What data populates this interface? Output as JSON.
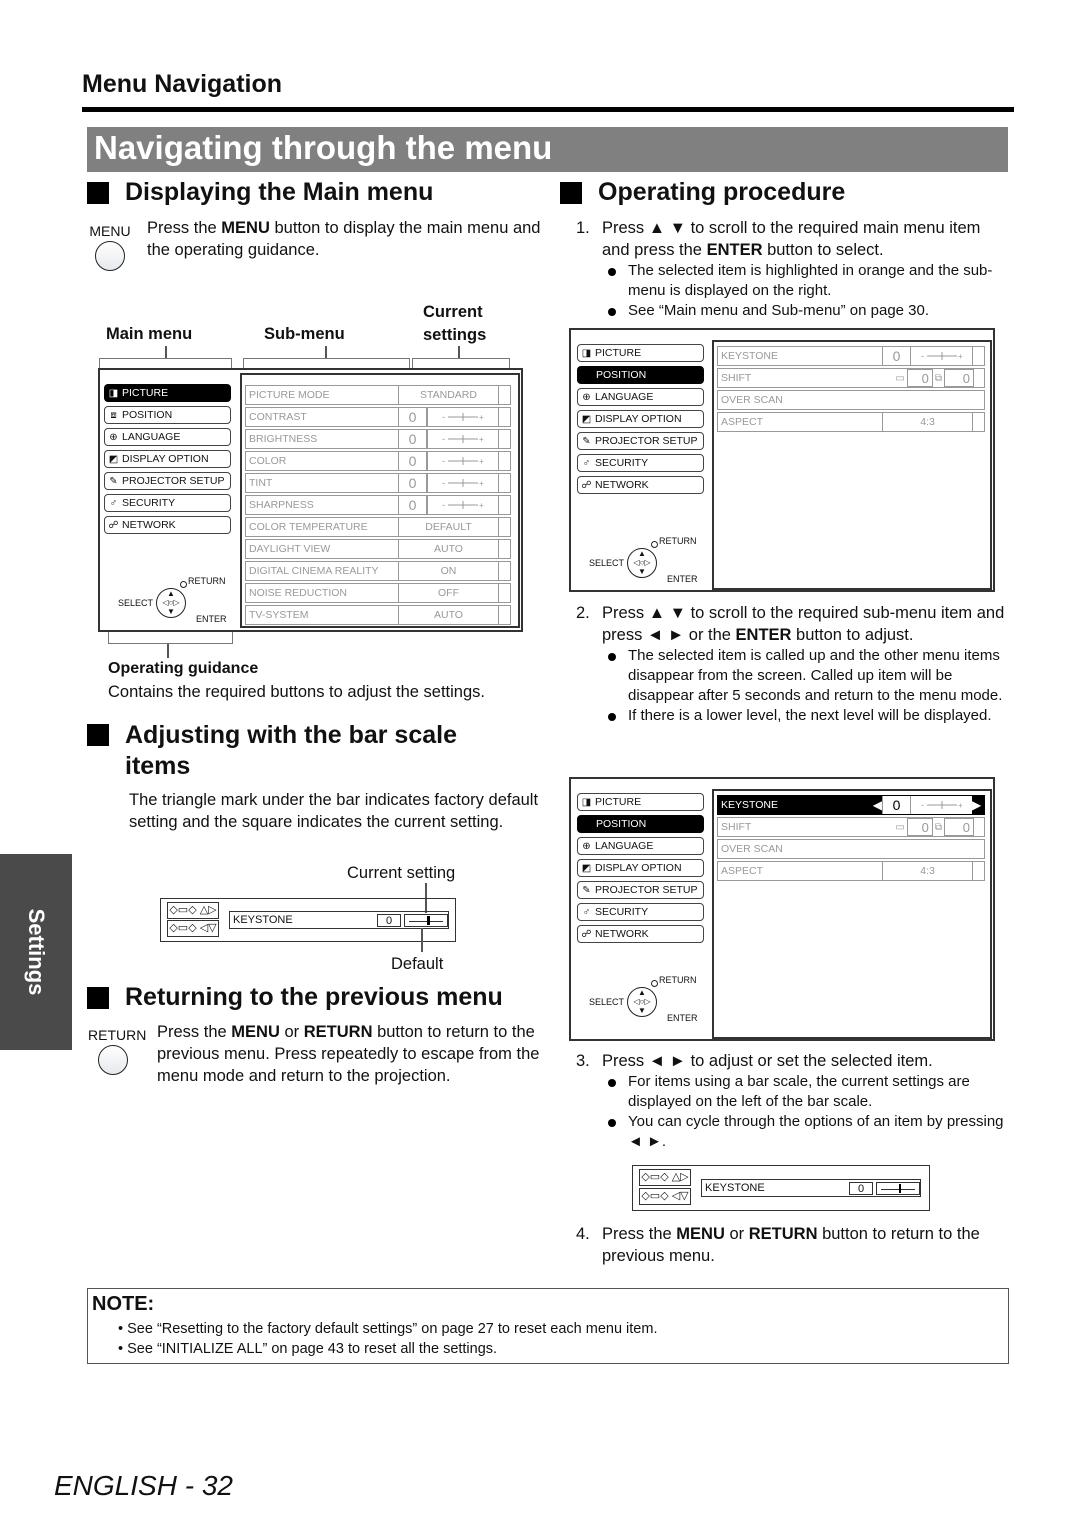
{
  "header": {
    "section": "Menu Navigation",
    "banner": "Navigating through the menu"
  },
  "side_tab": "Settings",
  "left": {
    "displaying": {
      "title": "Displaying the Main menu",
      "button_label": "MENU",
      "text_pre": "Press the ",
      "text_bold": "MENU",
      "text_post": " button to display the main menu and the operating guidance."
    },
    "diagram_labels": {
      "main_menu": "Main menu",
      "sub_menu": "Sub-menu",
      "current_settings_1": "Current",
      "current_settings_2": "settings",
      "operating_guidance": "Operating guidance",
      "operating_guidance_desc": "Contains the required buttons to adjust the settings."
    },
    "adjusting": {
      "title_1": "Adjusting with the bar scale",
      "title_2": "items",
      "text": "The triangle mark under the bar indicates factory default setting and the square indicates the current setting.",
      "current_setting_label": "Current setting",
      "default_label": "Default",
      "item_label": "KEYSTONE",
      "item_value": "0"
    },
    "returning": {
      "title": "Returning to the previous menu",
      "button_label": "RETURN",
      "t1": "Press the ",
      "b1": "MENU",
      "t2": " or ",
      "b2": "RETURN",
      "t3": " button to return to the previous menu. Press repeatedly to escape from the menu mode and return to the projection."
    }
  },
  "main_menu_items": [
    {
      "label": "PICTURE",
      "icon": "picture-icon",
      "glyph": "◨"
    },
    {
      "label": "POSITION",
      "icon": "position-icon",
      "glyph": "⧈"
    },
    {
      "label": "LANGUAGE",
      "icon": "globe-icon",
      "glyph": "⊕"
    },
    {
      "label": "DISPLAY OPTION",
      "icon": "display-option-icon",
      "glyph": "◩"
    },
    {
      "label": "PROJECTOR SETUP",
      "icon": "projector-setup-icon",
      "glyph": "✎"
    },
    {
      "label": "SECURITY",
      "icon": "key-icon",
      "glyph": "♂"
    },
    {
      "label": "NETWORK",
      "icon": "network-icon",
      "glyph": "☍"
    }
  ],
  "guidance": {
    "return": "RETURN",
    "select": "SELECT",
    "enter": "ENTER"
  },
  "picture_submenu": [
    {
      "label": "PICTURE MODE",
      "value": "STANDARD",
      "bar": false
    },
    {
      "label": "CONTRAST",
      "value": "0",
      "bar": true
    },
    {
      "label": "BRIGHTNESS",
      "value": "0",
      "bar": true
    },
    {
      "label": "COLOR",
      "value": "0",
      "bar": true
    },
    {
      "label": "TINT",
      "value": "0",
      "bar": true
    },
    {
      "label": "SHARPNESS",
      "value": "0",
      "bar": true
    },
    {
      "label": "COLOR TEMPERATURE",
      "value": "DEFAULT",
      "bar": false
    },
    {
      "label": "DAYLIGHT VIEW",
      "value": "AUTO",
      "bar": false
    },
    {
      "label": "DIGITAL CINEMA REALITY",
      "value": "ON",
      "bar": false
    },
    {
      "label": "NOISE REDUCTION",
      "value": "OFF",
      "bar": false
    },
    {
      "label": "TV-SYSTEM",
      "value": "AUTO",
      "bar": false
    }
  ],
  "position_submenu": [
    {
      "label": "KEYSTONE",
      "value": "0"
    },
    {
      "label": "SHIFT",
      "value_h": "0",
      "value_v": "0"
    },
    {
      "label": "OVER SCAN",
      "value": ""
    },
    {
      "label": "ASPECT",
      "value": "4:3"
    }
  ],
  "right": {
    "title": "Operating procedure",
    "step1": {
      "num": "1.",
      "t1": "Press ▲ ▼ to scroll to the required main menu item and press the ",
      "b1": "ENTER",
      "t2": " button to select.",
      "bullets": [
        "The selected item is highlighted in orange and the sub-menu is displayed on the right.",
        "See “Main menu and Sub-menu” on page 30."
      ]
    },
    "step2": {
      "num": "2.",
      "t1": "Press ▲ ▼ to scroll to the required sub-menu item and press ◄ ► or the ",
      "b1": "ENTER",
      "t2": " button to adjust.",
      "bullets": [
        "The selected item is called up and the other menu items disappear from the screen. Called up item will be disappear after 5 seconds and return to the menu mode.",
        "If there is a lower level, the next level will be displayed."
      ]
    },
    "step3": {
      "num": "3.",
      "text": "Press ◄ ► to adjust or set the selected item.",
      "bullets": [
        "For items using a bar scale, the current settings are displayed on the left of the bar scale.",
        "You can cycle through the options of an item by pressing ◄ ►."
      ]
    },
    "step4": {
      "num": "4.",
      "t1": "Press the ",
      "b1": "MENU",
      "t2": " or ",
      "b2": "RETURN",
      "t3": " button to return to the previous menu."
    }
  },
  "note": {
    "title": "NOTE:",
    "items": [
      "See “Resetting to the factory default settings” on page 27 to reset each menu item.",
      "See “INITIALIZE ALL” on page 43 to reset all the settings."
    ]
  },
  "footer": {
    "lang": "ENGLISH",
    "sep": " - ",
    "page": "32"
  }
}
